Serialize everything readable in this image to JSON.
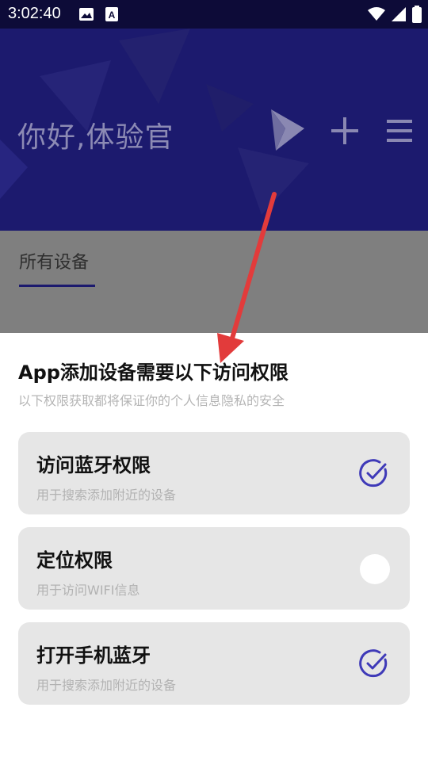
{
  "status_bar": {
    "time": "3:02:40",
    "icons": [
      "image-icon",
      "a-icon",
      "wifi-icon",
      "signal-icon",
      "battery-icon"
    ]
  },
  "header": {
    "greeting": "你好,体验官",
    "icons": [
      "logo-icon",
      "add-icon",
      "menu-icon"
    ],
    "background_color": "#1c1a6e"
  },
  "tabs": [
    {
      "label": "所有设备",
      "selected": true
    }
  ],
  "sheet": {
    "title": "App添加设备需要以下访问权限",
    "subtitle": "以下权限获取都将保证你的个人信息隐私的安全",
    "permissions": [
      {
        "title": "访问蓝牙权限",
        "description": "用于搜索添加附近的设备",
        "granted": true
      },
      {
        "title": "定位权限",
        "description": "用于访问WIFI信息",
        "granted": false
      },
      {
        "title": "打开手机蓝牙",
        "description": "用于搜索添加附近的设备",
        "granted": true
      }
    ]
  },
  "colors": {
    "accent": "#3f3ab8",
    "annotation_arrow": "#e23b3b",
    "card_bg": "#e6e6e6"
  }
}
